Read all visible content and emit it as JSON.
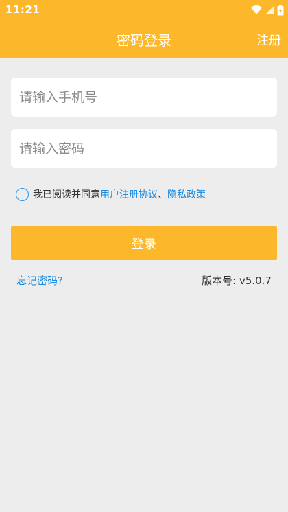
{
  "status_bar": {
    "time": "11:21",
    "icons": [
      "wifi-icon",
      "signal-icon",
      "battery-icon"
    ]
  },
  "header": {
    "title": "密码登录",
    "register_label": "注册"
  },
  "form": {
    "phone_placeholder": "请输入手机号",
    "phone_value": "",
    "password_placeholder": "请输入密码",
    "password_value": "",
    "agree_prefix": "我已阅读并同意",
    "agreement_link": "用户注册协议",
    "separator": "、",
    "privacy_link": "隐私政策",
    "agree_checked": false
  },
  "login_button": "登录",
  "footer": {
    "forgot_label": "忘记密码?",
    "version_text": "版本号: v5.0.7"
  },
  "colors": {
    "accent": "#fcb82a",
    "link": "#1a8ae0",
    "background": "#ededed"
  }
}
